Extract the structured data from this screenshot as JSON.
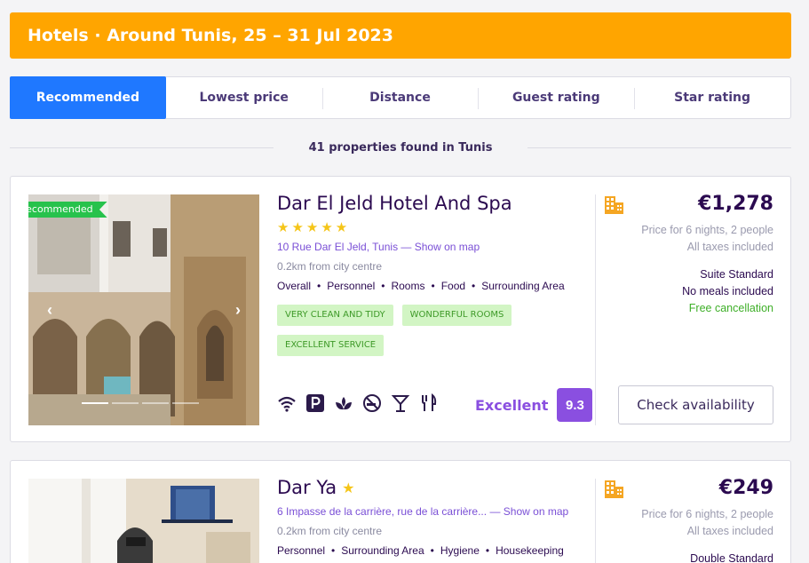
{
  "header": {
    "title": "Hotels · Around Tunis, 25 – 31 Jul 2023"
  },
  "sort_tabs": [
    {
      "label": "Recommended",
      "active": true
    },
    {
      "label": "Lowest price"
    },
    {
      "label": "Distance"
    },
    {
      "label": "Guest rating"
    },
    {
      "label": "Star rating"
    }
  ],
  "results_count": "41 properties found in Tunis",
  "hotels": [
    {
      "badge": "Recommended",
      "name": "Dar El Jeld Hotel And Spa",
      "stars": "★★★★★",
      "address": "10 Rue Dar El Jeld, Tunis",
      "map_link": "— Show on map",
      "distance": "0.2km from city centre",
      "review_categories": [
        "Overall",
        "Personnel",
        "Rooms",
        "Food",
        "Surrounding Area"
      ],
      "tags": [
        "VERY CLEAN AND TIDY",
        "WONDERFUL ROOMS",
        "EXCELLENT SERVICE"
      ],
      "amenities": [
        "wifi-icon",
        "parking-icon",
        "spa-icon",
        "no-smoking-icon",
        "bar-icon",
        "restaurant-icon"
      ],
      "rating_label": "Excellent",
      "rating_score": "9.3",
      "price": "€1,278",
      "price_note": "Price for 6 nights, 2 people",
      "taxes_note": "All taxes included",
      "room_type": "Suite Standard",
      "meals": "No meals included",
      "cancellation": "Free cancellation",
      "cta": "Check availability"
    },
    {
      "name": "Dar Ya",
      "stars": "★",
      "address": "6 Impasse de la carrière, rue de la carrière...",
      "map_link": "— Show on map",
      "distance": "0.2km from city centre",
      "review_categories": [
        "Personnel",
        "Surrounding Area",
        "Hygiene",
        "Housekeeping"
      ],
      "price": "€249",
      "price_note": "Price for 6 nights, 2 people",
      "taxes_note": "All taxes included",
      "room_type": "Double Standard"
    }
  ],
  "colors": {
    "accent": "#ffa500",
    "primary": "#1f78ff",
    "rating": "#8a4fe0",
    "tag_bg": "#d2f5c4",
    "tag_fg": "#3e9a28"
  }
}
